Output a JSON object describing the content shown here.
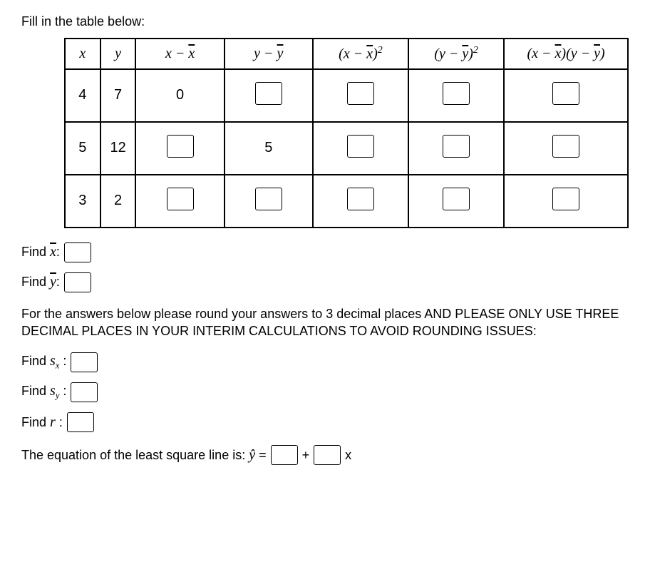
{
  "instruction": "Fill in the table below:",
  "headers": {
    "x": "x",
    "y": "y",
    "xdiff": "x − x̄",
    "ydiff": "y − ȳ",
    "xsq": "(x − x̄)²",
    "ysq": "(y − ȳ)²",
    "prod": "(x − x̄)(y − ȳ)"
  },
  "rows": [
    {
      "x": "4",
      "y": "7",
      "xdiff": "0",
      "ydiff": null,
      "xsq": null,
      "ysq": null,
      "prod": null
    },
    {
      "x": "5",
      "y": "12",
      "xdiff": null,
      "ydiff": "5",
      "xsq": null,
      "ysq": null,
      "prod": null
    },
    {
      "x": "3",
      "y": "2",
      "xdiff": null,
      "ydiff": null,
      "xsq": null,
      "ysq": null,
      "prod": null
    }
  ],
  "find_xbar_label": "Find x̄:",
  "find_ybar_label": "Find ȳ:",
  "note": "For the answers below please round your answers to 3 decimal places AND PLEASE ONLY USE THREE DECIMAL PLACES IN YOUR INTERIM CALCULATIONS TO AVOID ROUNDING ISSUES:",
  "find_sx_label": "Find sₓ :",
  "find_sy_label": "Find sᵧ :",
  "find_r_label": "Find r :",
  "eq_text": "The equation of the least square line is: ŷ =",
  "plus": "+",
  "times_x": "x"
}
